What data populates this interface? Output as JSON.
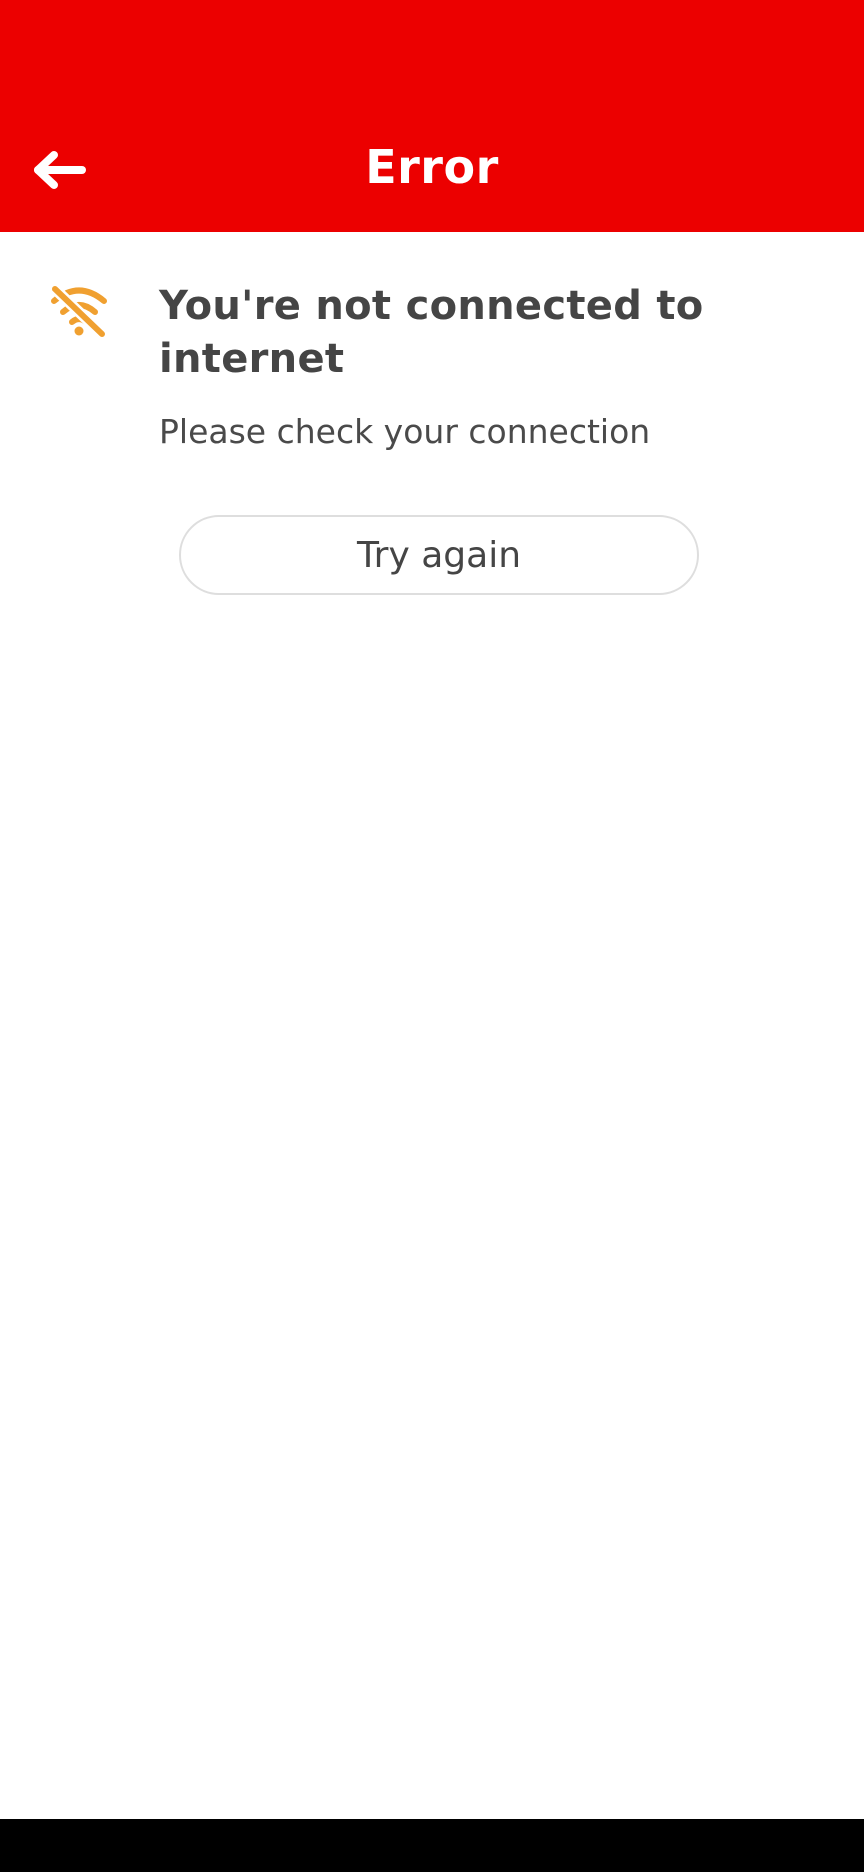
{
  "app_bar": {
    "title": "Error",
    "background_color": "#EC0000",
    "back_icon": "arrow-left-icon"
  },
  "message": {
    "icon": "wifi-off-icon",
    "icon_color": "#F0A030",
    "title": "You're not connected to internet",
    "subtitle": "Please check your connection"
  },
  "actions": {
    "try_again_label": "Try again"
  }
}
